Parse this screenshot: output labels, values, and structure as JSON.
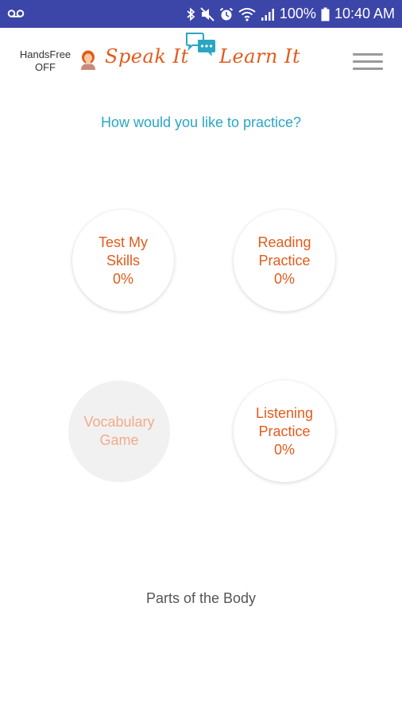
{
  "status_bar": {
    "battery_percent": "100%",
    "time": "10:40 AM",
    "background_color": "#3c45a8",
    "left_icons": [
      "voicemail-icon"
    ],
    "right_icons": [
      "bluetooth-icon",
      "mute-icon",
      "alarm-icon",
      "wifi-icon",
      "signal-icon",
      "battery-icon"
    ]
  },
  "header": {
    "handsfree_label": "HandsFree",
    "handsfree_state": "OFF",
    "logo_left": "Speak It",
    "logo_right": "Learn It",
    "brand_color": "#e35b1b",
    "accent_color": "#2aa6c4",
    "menu_icon": "hamburger-menu-icon"
  },
  "prompt": "How would you like to practice?",
  "options": [
    {
      "label_line1": "Test My",
      "label_line2": "Skills",
      "progress": "0%",
      "enabled": true
    },
    {
      "label_line1": "Reading",
      "label_line2": "Practice",
      "progress": "0%",
      "enabled": true
    },
    {
      "label_line1": "Vocabulary",
      "label_line2": "Game",
      "enabled": false
    },
    {
      "label_line1": "Listening",
      "label_line2": "Practice",
      "progress": "0%",
      "enabled": true
    }
  ],
  "topic": "Parts of the Body"
}
